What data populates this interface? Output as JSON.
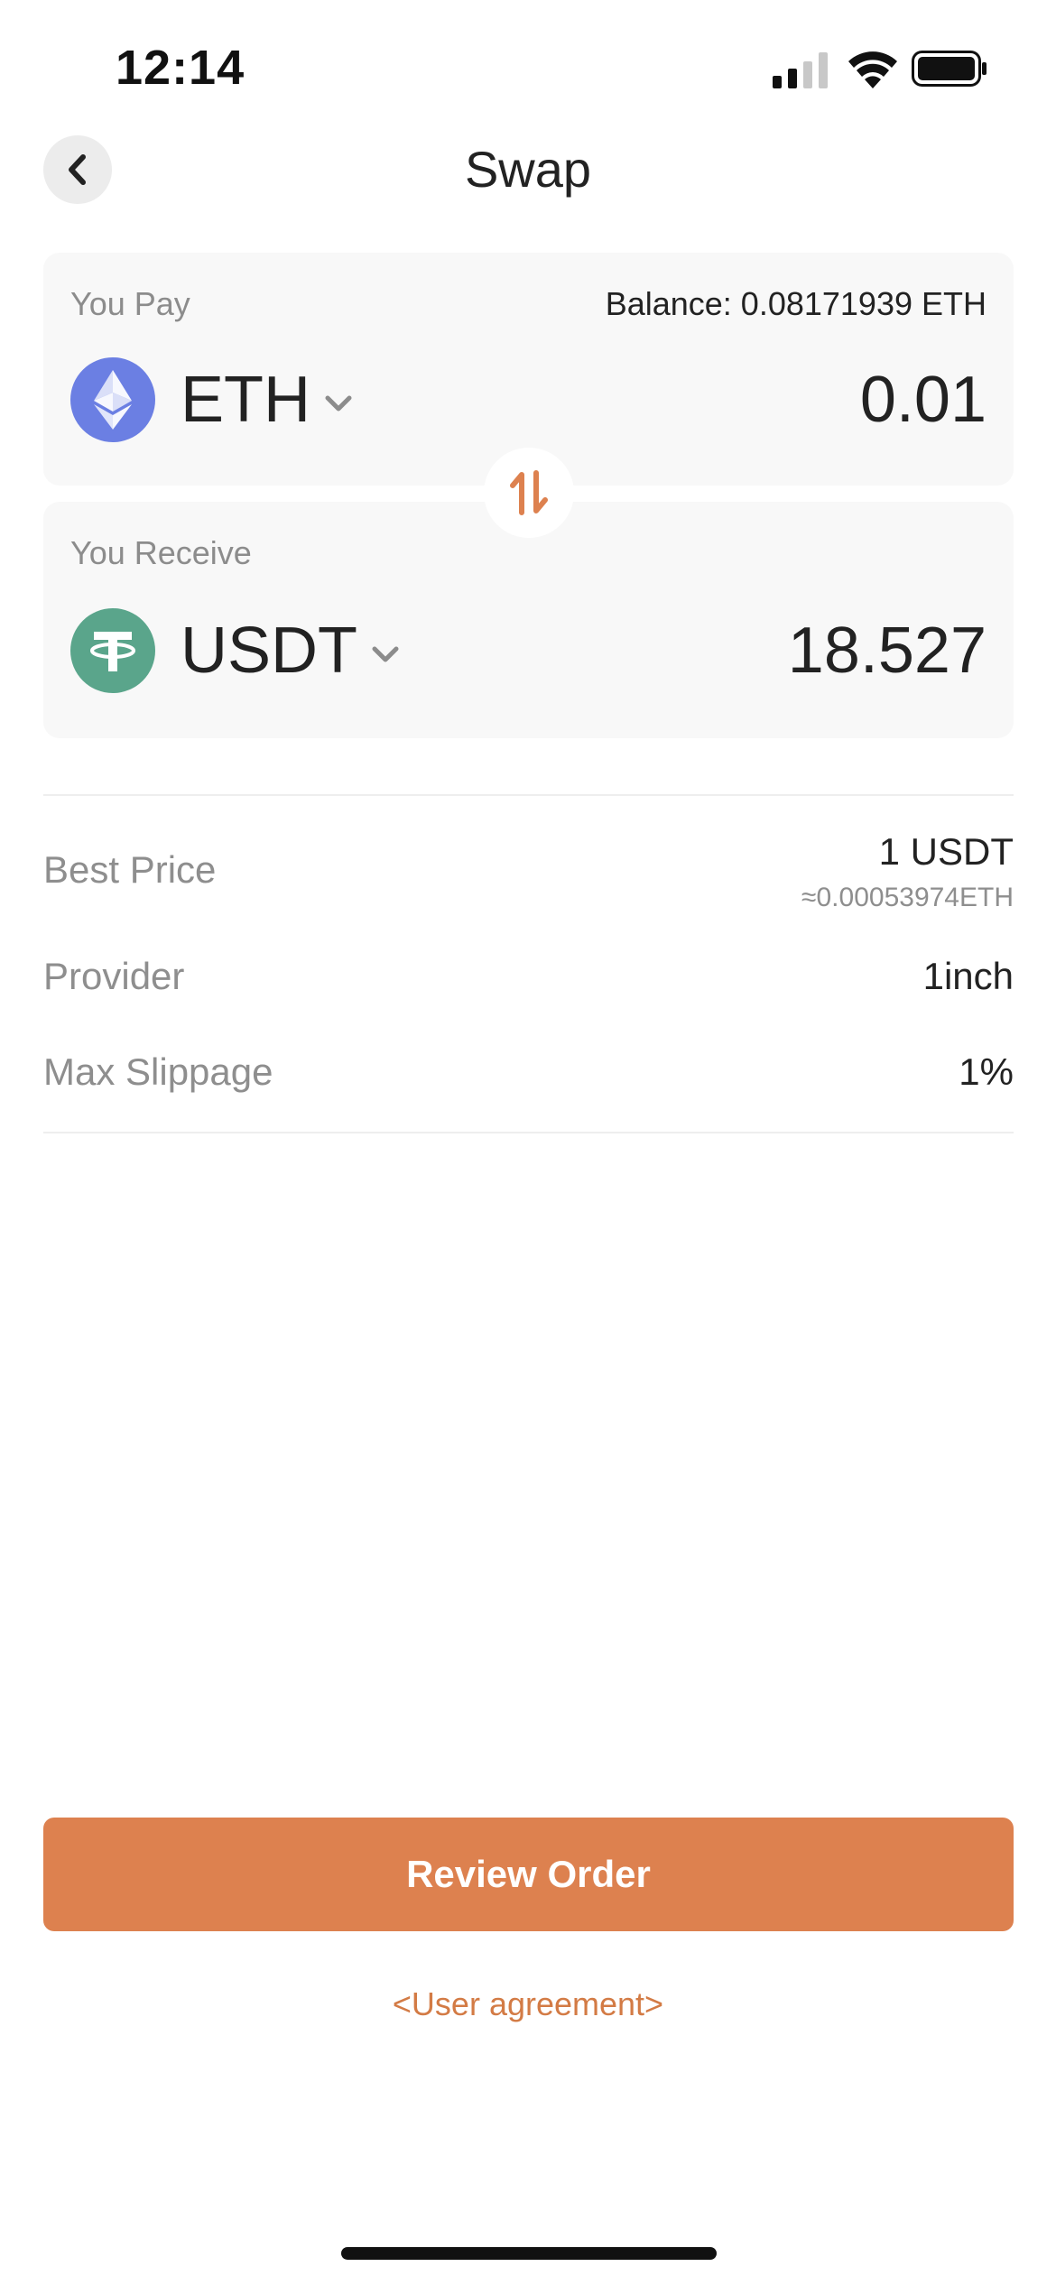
{
  "status_bar": {
    "time": "12:14"
  },
  "header": {
    "title": "Swap"
  },
  "pay": {
    "label": "You Pay",
    "balance": "Balance: 0.08171939 ETH",
    "token": "ETH",
    "amount": "0.01"
  },
  "receive": {
    "label": "You Receive",
    "token": "USDT",
    "amount": "18.527"
  },
  "details": {
    "best_price_label": "Best Price",
    "best_price_value": "1 USDT",
    "best_price_sub": "≈0.00053974ETH",
    "provider_label": "Provider",
    "provider_value": "1inch",
    "slippage_label": "Max Slippage",
    "slippage_value": "1%"
  },
  "actions": {
    "review_label": "Review Order",
    "agreement_label": "<User agreement>"
  },
  "colors": {
    "accent": "#dd814f",
    "eth": "#6b7fe3",
    "usdt": "#5aa58b"
  },
  "icons": {
    "back": "chevron-left-icon",
    "swap": "swap-vertical-icon",
    "eth": "ethereum-icon",
    "usdt": "tether-icon",
    "dropdown": "chevron-down-icon"
  }
}
